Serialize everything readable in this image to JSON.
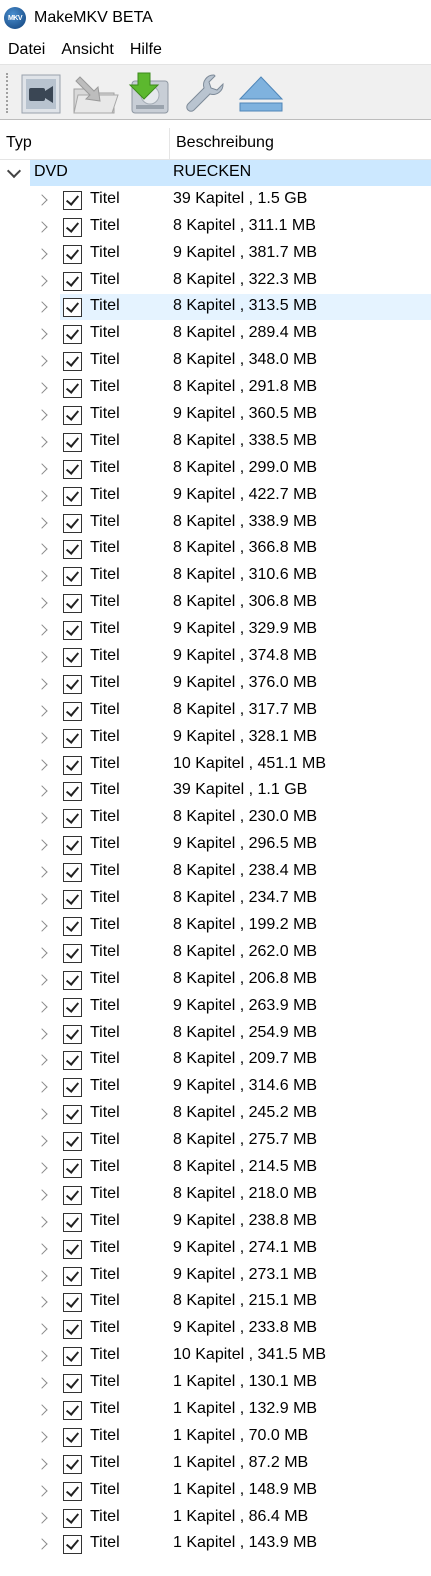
{
  "window": {
    "title": "MakeMKV BETA",
    "icon_label": "MKV"
  },
  "menu": [
    "Datei",
    "Ansicht",
    "Hilfe"
  ],
  "toolbar": {
    "buttons": [
      {
        "name": "open-files-button",
        "icon": "video-camera-icon"
      },
      {
        "name": "open-folder-button",
        "icon": "folder-arrow-icon"
      },
      {
        "name": "backup-button",
        "icon": "disk-download-icon"
      },
      {
        "name": "settings-button",
        "icon": "wrench-icon"
      },
      {
        "name": "eject-button",
        "icon": "eject-icon"
      }
    ]
  },
  "columns": {
    "type": "Typ",
    "description": "Beschreibung"
  },
  "tree": {
    "root": {
      "type": "DVD",
      "description": "RUECKEN",
      "expanded": true,
      "selected": true
    },
    "item_type": "Titel",
    "items": [
      "39 Kapitel , 1.5 GB",
      "8 Kapitel , 311.1 MB",
      "9 Kapitel , 381.7 MB",
      "8 Kapitel , 322.3 MB",
      "8 Kapitel , 313.5 MB",
      "8 Kapitel , 289.4 MB",
      "8 Kapitel , 348.0 MB",
      "8 Kapitel , 291.8 MB",
      "9 Kapitel , 360.5 MB",
      "8 Kapitel , 338.5 MB",
      "8 Kapitel , 299.0 MB",
      "9 Kapitel , 422.7 MB",
      "8 Kapitel , 338.9 MB",
      "8 Kapitel , 366.8 MB",
      "8 Kapitel , 310.6 MB",
      "8 Kapitel , 306.8 MB",
      "9 Kapitel , 329.9 MB",
      "9 Kapitel , 374.8 MB",
      "9 Kapitel , 376.0 MB",
      "8 Kapitel , 317.7 MB",
      "9 Kapitel , 328.1 MB",
      "10 Kapitel , 451.1 MB",
      "39 Kapitel , 1.1 GB",
      "8 Kapitel , 230.0 MB",
      "9 Kapitel , 296.5 MB",
      "8 Kapitel , 238.4 MB",
      "8 Kapitel , 234.7 MB",
      "8 Kapitel , 199.2 MB",
      "8 Kapitel , 262.0 MB",
      "8 Kapitel , 206.8 MB",
      "9 Kapitel , 263.9 MB",
      "8 Kapitel , 254.9 MB",
      "8 Kapitel , 209.7 MB",
      "9 Kapitel , 314.6 MB",
      "8 Kapitel , 245.2 MB",
      "8 Kapitel , 275.7 MB",
      "8 Kapitel , 214.5 MB",
      "8 Kapitel , 218.0 MB",
      "9 Kapitel , 238.8 MB",
      "9 Kapitel , 274.1 MB",
      "9 Kapitel , 273.1 MB",
      "8 Kapitel , 215.1 MB",
      "9 Kapitel , 233.8 MB",
      "10 Kapitel , 341.5 MB",
      "1 Kapitel , 130.1 MB",
      "1 Kapitel , 132.9 MB",
      "1 Kapitel , 70.0 MB",
      "1 Kapitel , 87.2 MB",
      "1 Kapitel , 148.9 MB",
      "1 Kapitel , 86.4 MB",
      "1 Kapitel , 143.9 MB"
    ],
    "hover_index": 4,
    "checked": true
  },
  "colors": {
    "selection": "#cce8ff",
    "hover": "#e5f3ff",
    "toolbar_bg": "#f0f0f0"
  }
}
